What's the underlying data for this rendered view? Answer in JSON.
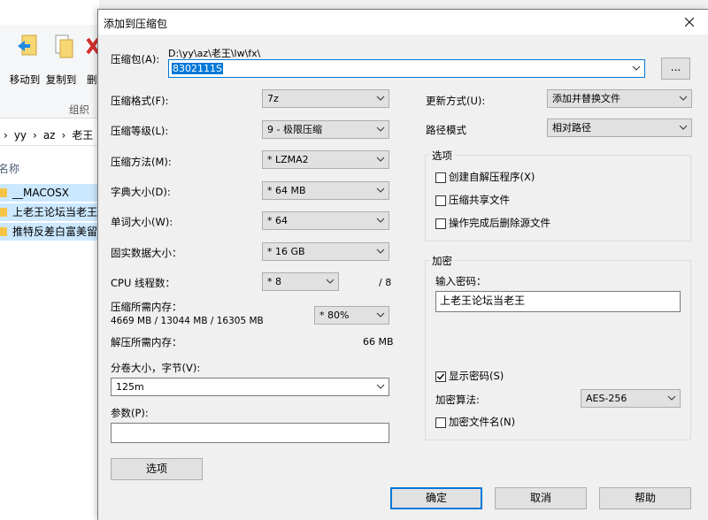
{
  "explorer": {
    "buttons": {
      "move_to": "移动到",
      "copy_to": "复制到",
      "delete_partial": "删"
    },
    "group_label": "组织",
    "breadcrumb": [
      "›",
      "yy",
      "›",
      "az",
      "›",
      "老王"
    ],
    "column_name": "名称",
    "files": [
      "__MACOSX",
      "上老王论坛当老王",
      "推特反差白富美留"
    ]
  },
  "dialog": {
    "title": "添加到压缩包",
    "archive_label": "压缩包(A):",
    "archive_path": "D:\\yy\\az\\老王\\lw\\fx\\",
    "archive_name": "8302111S",
    "browse_label": "...",
    "format_label": "压缩格式(F):",
    "format_value": "7z",
    "level_label": "压缩等级(L):",
    "level_value": "9 - 极限压缩",
    "method_label": "压缩方法(M):",
    "method_value": "* LZMA2",
    "dict_label": "字典大小(D):",
    "dict_value": "* 64 MB",
    "word_label": "单词大小(W):",
    "word_value": "* 64",
    "solid_label": "固实数据大小：",
    "solid_value": "* 16 GB",
    "threads_label": "CPU 线程数：",
    "threads_value": "* 8",
    "threads_max": "/ 8",
    "mem_comp_label": "压缩所需内存：",
    "mem_comp_detail": "4669 MB / 13044 MB / 16305 MB",
    "mem_comp_value": "* 80%",
    "mem_decomp_label": "解压所需内存：",
    "mem_decomp_value": "66 MB",
    "volume_label": "分卷大小，字节(V):",
    "volume_value": "125m",
    "params_label": "参数(P):",
    "params_value": "",
    "options_button": "选项",
    "update_label": "更新方式(U):",
    "update_value": "添加并替换文件",
    "path_label": "路径模式",
    "path_value": "相对路径",
    "options_group": {
      "title": "选项",
      "sfx": "创建自解压程序(X)",
      "shared": "压缩共享文件",
      "delete_after": "操作完成后删除源文件"
    },
    "encryption_group": {
      "title": "加密",
      "password_label": "输入密码：",
      "password_value": "上老王论坛当老王",
      "show_password": "显示密码(S)",
      "method_label": "加密算法:",
      "method_value": "AES-256",
      "encrypt_names": "加密文件名(N)"
    },
    "ok": "确定",
    "cancel": "取消",
    "help": "帮助"
  }
}
